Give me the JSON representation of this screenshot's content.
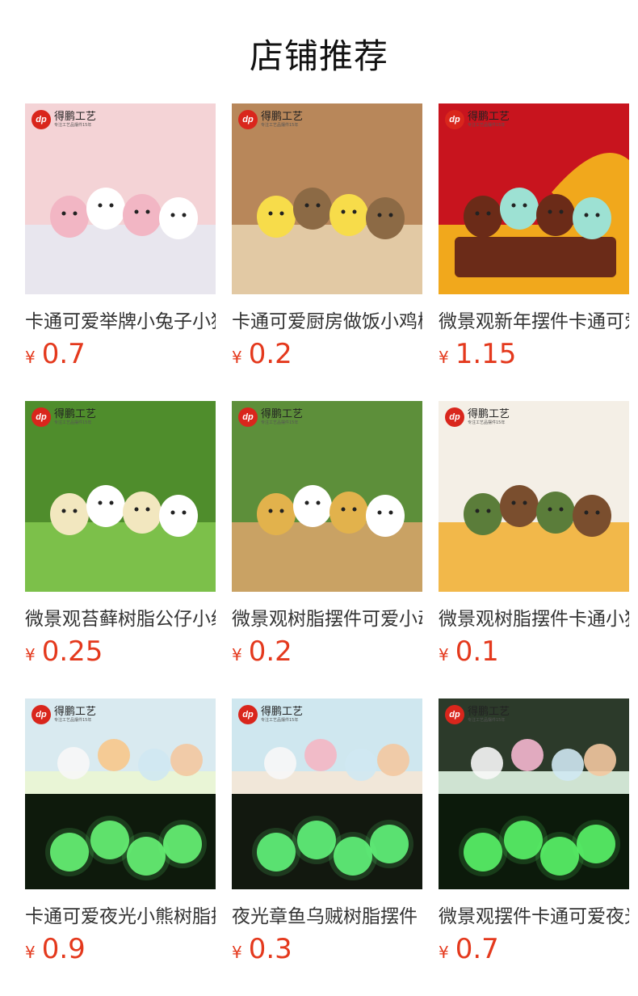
{
  "section_title": "店铺推荐",
  "brand": {
    "logo_text": "dp",
    "name": "得鹏工艺",
    "tagline": "专注工艺品摆件15年"
  },
  "currency": "¥",
  "products": [
    {
      "name": "卡通可爱举牌小兔子小猪树脂摆件",
      "price": "0.7",
      "scene": "pastel"
    },
    {
      "name": "卡通可爱厨房做饭小鸡树脂摆件",
      "price": "0.2",
      "scene": "kitchen"
    },
    {
      "name": "微景观新年摆件卡通可爱小龙",
      "price": "1.15",
      "scene": "red"
    },
    {
      "name": "微景观苔藓树脂公仔小绵羊",
      "price": "0.25",
      "scene": "moss"
    },
    {
      "name": "微景观树脂摆件可爱小动物",
      "price": "0.2",
      "scene": "garden"
    },
    {
      "name": "微景观树脂摆件卡通小狗",
      "price": "0.1",
      "scene": "dogs"
    },
    {
      "name": "卡通可爱夜光小熊树脂摆件",
      "price": "0.9",
      "scene": "glow1"
    },
    {
      "name": "夜光章鱼乌贼树脂摆件",
      "price": "0.3",
      "scene": "glow2"
    },
    {
      "name": "微景观摆件卡通可爱夜光恐龙",
      "price": "0.7",
      "scene": "glow3"
    }
  ]
}
